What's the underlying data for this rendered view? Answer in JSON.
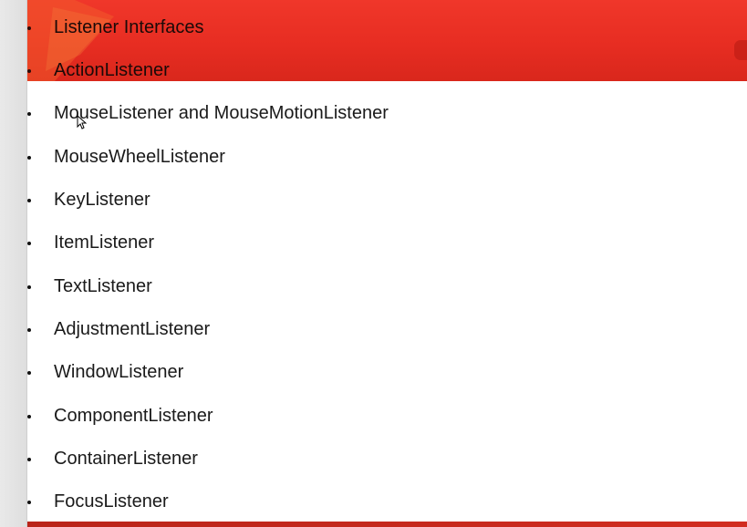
{
  "slide": {
    "colors": {
      "header_band": "#e72d22",
      "footer_band": "#c42619",
      "background": "#ffffff",
      "text": "#1a1a1a"
    },
    "bullets": [
      {
        "label": "Listener Interfaces"
      },
      {
        "label": "ActionListener"
      },
      {
        "label": "MouseListener and MouseMotionListener"
      },
      {
        "label": "MouseWheelListener"
      },
      {
        "label": "KeyListener"
      },
      {
        "label": "ItemListener"
      },
      {
        "label": "TextListener"
      },
      {
        "label": "AdjustmentListener"
      },
      {
        "label": "WindowListener"
      },
      {
        "label": "ComponentListener"
      },
      {
        "label": "ContainerListener"
      },
      {
        "label": "FocusListener"
      }
    ]
  }
}
